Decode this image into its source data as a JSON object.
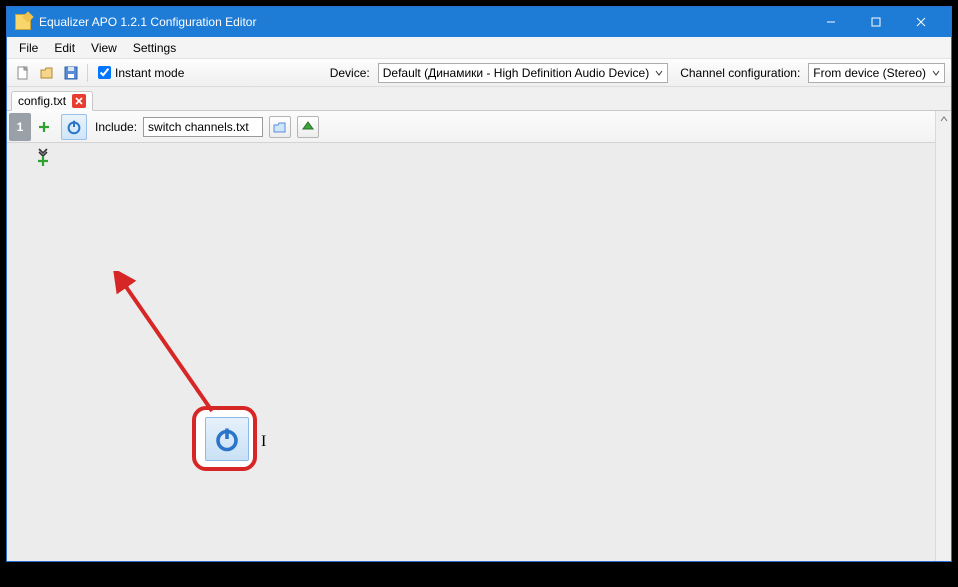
{
  "window": {
    "title": "Equalizer APO 1.2.1 Configuration Editor"
  },
  "menu": {
    "file": "File",
    "edit": "Edit",
    "view": "View",
    "settings": "Settings"
  },
  "toolbar": {
    "instant_mode_label": "Instant mode",
    "instant_mode_checked": true,
    "device_label": "Device:",
    "device_value": "Default (Динамики - High Definition Audio Device)",
    "channel_cfg_label": "Channel configuration:",
    "channel_cfg_value": "From device (Stereo)"
  },
  "tabs": [
    {
      "label": "config.txt"
    }
  ],
  "row": {
    "number": "1",
    "include_label": "Include:",
    "include_value": "switch channels.txt"
  },
  "colors": {
    "accent": "#1e7bd6",
    "callout": "#d72626"
  }
}
